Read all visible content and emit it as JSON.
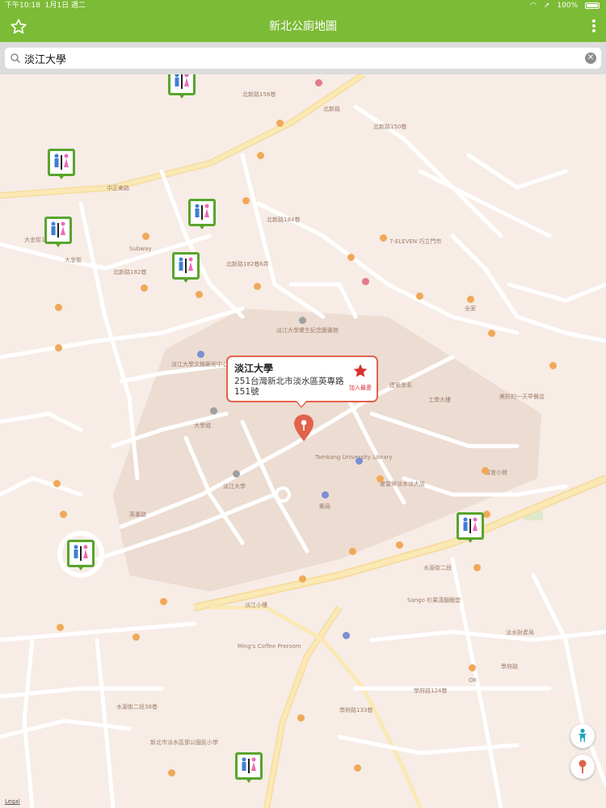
{
  "status_bar": {
    "time": "下午10:18",
    "date": "1月1日 週二",
    "battery": "100%"
  },
  "app_bar": {
    "title": "新北公廁地圖"
  },
  "search": {
    "value": "淡江大學"
  },
  "callout": {
    "title": "淡江大學",
    "address": "251台灣新北市淡水區英專路151號",
    "favorite_label": "加入最愛"
  },
  "map": {
    "legal": "Legal",
    "labels": [
      "北新路",
      "北新路150巷",
      "北新路158巷",
      "北新路184巷",
      "北新路182巷",
      "北新路182巷6弄",
      "大忠街",
      "大忠街133巷",
      "英專路",
      "大學城",
      "淡江大學",
      "淡江大學覺生紀念圖書館",
      "淡江大學文錙藝術中心",
      "Tamkang University Library",
      "工學大樓",
      "建築學系",
      "郵局",
      "淡江小樓",
      "學府路",
      "學府路124巷",
      "學府路133巷",
      "水源街二段",
      "水源街二段38巷",
      "中正東路",
      "7-ELEVEN 巧立門市",
      "OK",
      "Subway",
      "Ming's Coffee Preroom",
      "Sango 杉果漢翻麵堂",
      "淡水財產局",
      "麥當勞淡水淡大店",
      "新北市淡水區鄧公國民小學",
      "美好的一天早餐店",
      "舊宮小館",
      "全家"
    ]
  },
  "icons": {
    "favorite": "star-outline-icon",
    "menu": "more-vertical-icon",
    "search": "search-icon",
    "clear": "clear-icon",
    "toilet": "toilet-pin-icon",
    "location": "map-pin-icon",
    "person": "person-icon",
    "place": "place-pin-icon"
  },
  "colors": {
    "app_bar": "#7cbb35",
    "toilet_pin": "#58a52c",
    "callout_border": "#e2624b",
    "favorite_star": "#d9322d"
  }
}
